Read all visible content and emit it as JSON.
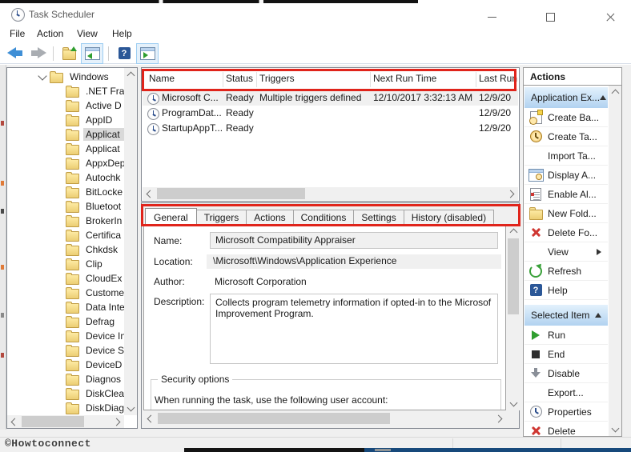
{
  "window": {
    "title": "Task Scheduler"
  },
  "menu": {
    "items": [
      "File",
      "Action",
      "View",
      "Help"
    ]
  },
  "tree": {
    "root": "Windows",
    "selected": "Applicat",
    "items": [
      ".NET Fra",
      "Active D",
      "AppID",
      "Applicat",
      "Applicat",
      "AppxDep",
      "Autochk",
      "BitLocke",
      "Bluetoot",
      "BrokerIn",
      "Certifica",
      "Chkdsk",
      "Clip",
      "CloudEx",
      "Custome",
      "Data Inte",
      "Defrag",
      "Device In",
      "Device S",
      "DeviceD",
      "Diagnos",
      "DiskClea",
      "DiskDiag"
    ]
  },
  "task_list": {
    "columns": [
      "Name",
      "Status",
      "Triggers",
      "Next Run Time",
      "Last Run"
    ],
    "rows": [
      {
        "name": "Microsoft C...",
        "status": "Ready",
        "triggers": "Multiple triggers defined",
        "next_run_time": "12/10/2017 3:32:13 AM",
        "last_run": "12/9/20"
      },
      {
        "name": "ProgramDat...",
        "status": "Ready",
        "triggers": "",
        "next_run_time": "",
        "last_run": "12/9/20"
      },
      {
        "name": "StartupAppT...",
        "status": "Ready",
        "triggers": "",
        "next_run_time": "",
        "last_run": "12/9/20"
      }
    ]
  },
  "details": {
    "tabs": [
      "General",
      "Triggers",
      "Actions",
      "Conditions",
      "Settings",
      "History (disabled)"
    ],
    "active_tab": "General",
    "name_label": "Name:",
    "name_value": "Microsoft Compatibility Appraiser",
    "location_label": "Location:",
    "location_value": "\\Microsoft\\Windows\\Application Experience",
    "author_label": "Author:",
    "author_value": "Microsoft Corporation",
    "description_label": "Description:",
    "description_line1": "Collects program telemetry information if opted-in to the Microsof",
    "description_line2": "Improvement Program.",
    "security_legend": "Security options",
    "security_text": "When running the task, use the following user account:"
  },
  "actions": {
    "title": "Actions",
    "group1_header": "Application Ex...",
    "group1_items": [
      "Create Ba...",
      "Create Ta...",
      "Import Ta...",
      "Display A...",
      "Enable Al...",
      "New Fold...",
      "Delete Fo...",
      "View",
      "Refresh",
      "Help"
    ],
    "group2_header": "Selected Item",
    "group2_items": [
      "Run",
      "End",
      "Disable",
      "Export...",
      "Properties",
      "Delete"
    ]
  },
  "icons": {
    "help_glyph": "?"
  },
  "watermark": "©Howtoconnect",
  "colors": {
    "annotation_red": "#e0241b",
    "action_header_blue": "#b1d2f0",
    "tree_selection_gray": "#d9d9d9",
    "taskbar_blue": "#17497b"
  }
}
